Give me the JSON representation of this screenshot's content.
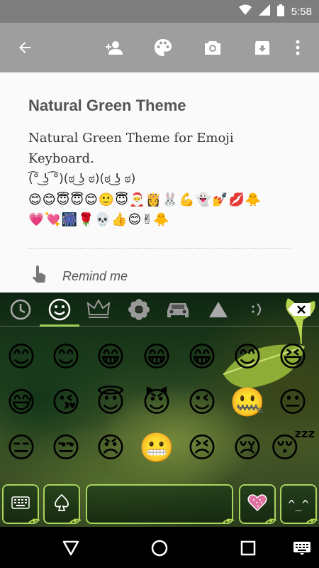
{
  "status_bar": {
    "time": "5:58",
    "icons": [
      "wifi-icon",
      "signal-icon",
      "battery-icon"
    ]
  },
  "app_bar": {
    "icons": [
      "back-arrow-icon",
      "add-person-icon",
      "palette-icon",
      "camera-icon",
      "archive-icon",
      "more-vert-icon"
    ]
  },
  "note": {
    "title": "Natural Green Theme",
    "body_line1": "Natural Green Theme for Emoji",
    "body_line2": "Keyboard.",
    "kaomoji_line": "(͡° ͜ʖ ͡°)(ಠ ͜ʖ ಠ)(ಠ ͜ʖ ಠ)",
    "emoji_line1": "😊😊😇😇😊🙂😇🎅👸🐰💪👻💅💋🐥",
    "emoji_line2": "💗💘🎆🌹💀👍😊✌🐥",
    "remind_label": "Remind me"
  },
  "keyboard": {
    "tabs": [
      "recent-icon",
      "smiley-icon",
      "crown-icon",
      "flower-icon",
      "car-icon",
      "triangle-icon",
      "emoticon-icon"
    ],
    "active_tab": "smiley-icon",
    "accent_color": "#9ad24e",
    "delete_icon": "backspace-icon",
    "emoji_rows": [
      [
        "😊",
        "😊",
        "😁",
        "😁",
        "😁",
        "😊",
        "😆"
      ],
      [
        "😅",
        "😘",
        "😇",
        "😈",
        "😉",
        "🤐",
        "😐"
      ],
      [
        "😑",
        "😒",
        "😠",
        "😬",
        "😣",
        "😢",
        "😴"
      ]
    ],
    "bottom_keys": {
      "keyboard_icon": "keyboard-icon",
      "spade_icon": "spade-icon",
      "heart_icon": "heart-icon",
      "kaomoji_label": "^_^"
    }
  },
  "nav_bar": {
    "icons": [
      "back-triangle-icon",
      "home-circle-icon",
      "recents-square-icon",
      "keyboard-switch-icon"
    ]
  }
}
